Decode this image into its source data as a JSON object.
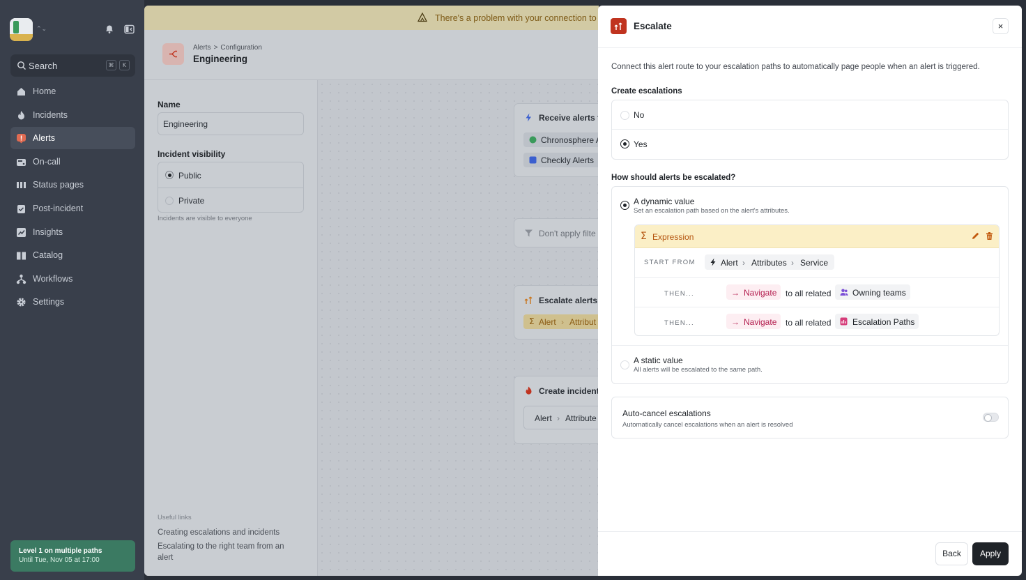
{
  "sidebar": {
    "search": {
      "label": "Search",
      "kbd1": "⌘",
      "kbd2": "K"
    },
    "items": [
      {
        "label": "Home",
        "icon": "home-icon"
      },
      {
        "label": "Incidents",
        "icon": "flame-icon"
      },
      {
        "label": "Alerts",
        "icon": "alert-icon",
        "active": true
      },
      {
        "label": "On-call",
        "icon": "pager-icon"
      },
      {
        "label": "Status pages",
        "icon": "bars-icon"
      },
      {
        "label": "Post-incident",
        "icon": "clipboard-icon"
      },
      {
        "label": "Insights",
        "icon": "chart-icon"
      },
      {
        "label": "Catalog",
        "icon": "book-icon"
      },
      {
        "label": "Workflows",
        "icon": "workflow-icon"
      },
      {
        "label": "Settings",
        "icon": "gear-icon"
      }
    ],
    "oncall": {
      "title": "Level 1 on multiple paths",
      "subtitle": "Until Tue, Nov 05 at 17:00"
    }
  },
  "main": {
    "banner": "There's a problem with your connection to Se",
    "breadcrumb": [
      "Alerts",
      ">",
      "Configuration"
    ],
    "title": "Engineering",
    "form": {
      "name_label": "Name",
      "name_value": "Engineering",
      "visibility_label": "Incident visibility",
      "options": [
        "Public",
        "Private"
      ],
      "visibility_help": "Incidents are visible to everyone",
      "useful_links_label": "Useful links",
      "links": [
        "Creating escalations and incidents",
        "Escalating to the right team from an",
        "alert"
      ]
    },
    "nodes": {
      "receive": {
        "title": "Receive alerts fr",
        "chips": [
          "Chronosphere A",
          "Checkly Alerts"
        ]
      },
      "filter": {
        "title": "Don't apply filte"
      },
      "escalate": {
        "title": "Escalate alerts t",
        "chip_a": "Alert",
        "chip_b": "Attribut"
      },
      "create": {
        "title": "Create incidents",
        "chip_a": "Alert",
        "chip_b": "Attribute"
      }
    }
  },
  "drawer": {
    "title": "Escalate",
    "close": "×",
    "description": "Connect this alert route to your escalation paths to automatically page people when an alert is triggered.",
    "create_label": "Create escalations",
    "create_options": [
      "No",
      "Yes"
    ],
    "how_label": "How should alerts be escalated?",
    "dynamic": {
      "title": "A dynamic value",
      "subtitle": "Set an escalation path based on the alert's attributes."
    },
    "expression": {
      "title": "Expression",
      "start_from": "START FROM",
      "start_path": [
        "Alert",
        "Attributes",
        "Service"
      ],
      "steps": [
        {
          "then": "THEN...",
          "action": "Navigate",
          "middle": "to all related",
          "target": "Owning teams"
        },
        {
          "then": "THEN...",
          "action": "Navigate",
          "middle": "to all related",
          "target": "Escalation Paths"
        }
      ]
    },
    "static": {
      "title": "A static value",
      "subtitle": "All alerts will be escalated to the same path."
    },
    "auto_cancel": {
      "title": "Auto-cancel escalations",
      "subtitle": "Automatically cancel escalations when an alert is resolved"
    },
    "back": "Back",
    "apply": "Apply"
  },
  "colors": {
    "accent": "#c0331f",
    "sidebar_bg": "#393f4b",
    "oncall_bg": "#3b7a62",
    "expression_bg": "#fbefc6",
    "navigate_text": "#b31d4e"
  }
}
